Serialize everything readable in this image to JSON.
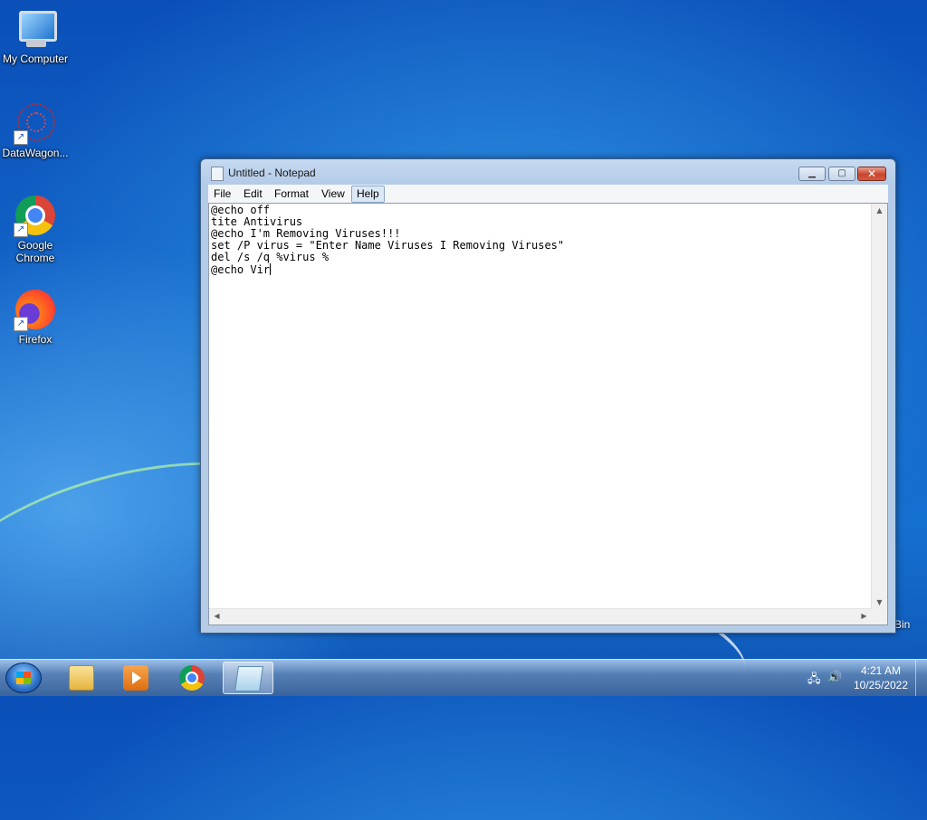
{
  "desktop": {
    "icons": [
      {
        "label": "My Computer",
        "icon": "computer-icon"
      },
      {
        "label": "DataWagon...",
        "icon": "datawagon-icon"
      },
      {
        "label": "Google Chrome",
        "icon": "chrome-icon"
      },
      {
        "label": "Firefox",
        "icon": "firefox-icon"
      }
    ],
    "recycle_bin_label": "Bin"
  },
  "window": {
    "title": "Untitled - Notepad",
    "menu": [
      "File",
      "Edit",
      "Format",
      "View",
      "Help"
    ],
    "active_menu": "Help",
    "lines": [
      "@echo off",
      "tite Antivirus",
      "@echo I'm Removing Viruses!!!",
      "set /P virus = \"Enter Name Viruses I Removing Viruses\"",
      "del /s /q %virus %",
      "@echo Vir"
    ]
  },
  "taskbar": {
    "apps": [
      "explorer-folder-icon",
      "media-player-icon",
      "chrome-icon",
      "notepad-icon"
    ],
    "active_app": "notepad-icon",
    "time": "4:21 AM",
    "date": "10/25/2022"
  }
}
